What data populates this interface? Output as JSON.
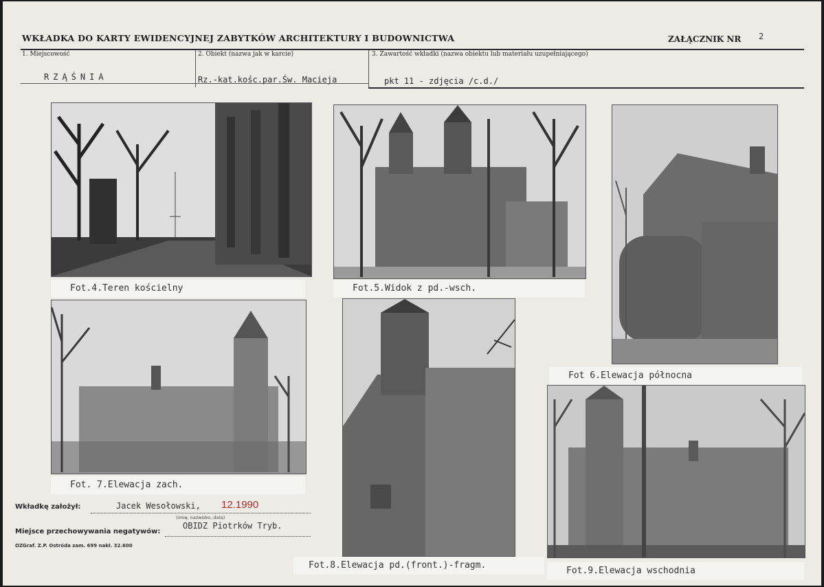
{
  "header": {
    "title": "WKŁADKA DO KARTY EWIDENCYJNEJ ZABYTKÓW ARCHITEKTURY I BUDOWNICTWA",
    "annex_label": "ZAŁĄCZNIK NR",
    "annex_number": "2"
  },
  "fields": {
    "locality_label": "1. Miejscowość",
    "locality_value": "RZĄŚNIA",
    "object_label": "2. Obiekt (nazwa jak w karcie)",
    "object_value": "Rz.-kat.kośc.par.Św. Macieja",
    "content_label": "3. Zawartość wkładki (nazwa obiektu lub materiału uzupełniającego)",
    "content_value": "pkt 11 - zdjęcia /c.d./"
  },
  "photos": [
    {
      "caption": "Fot.4.Teren kościelny"
    },
    {
      "caption": "Fot.5.Widok z pd.-wsch."
    },
    {
      "caption": "Fot 6.Elewacja północna"
    },
    {
      "caption": "Fot. 7.Elewacja zach."
    },
    {
      "caption": "Fot.8.Elewacja pd.(front.)-fragm."
    },
    {
      "caption": "Fot.9.Elewacja wschodnia"
    }
  ],
  "footer": {
    "prepared_label": "Wkładkę założył:",
    "prepared_value": "Jacek Wesołowski,",
    "prepared_date": "12.1990",
    "prepared_note": "(imię, nazwisko, data)",
    "negatives_label": "Miejsce przechowywania negatywów:",
    "negatives_value": "OBIDZ Piotrków Tryb.",
    "print_note": "OZGraf. Z.P. Ostróda zam. 699 nakł. 32.600"
  }
}
